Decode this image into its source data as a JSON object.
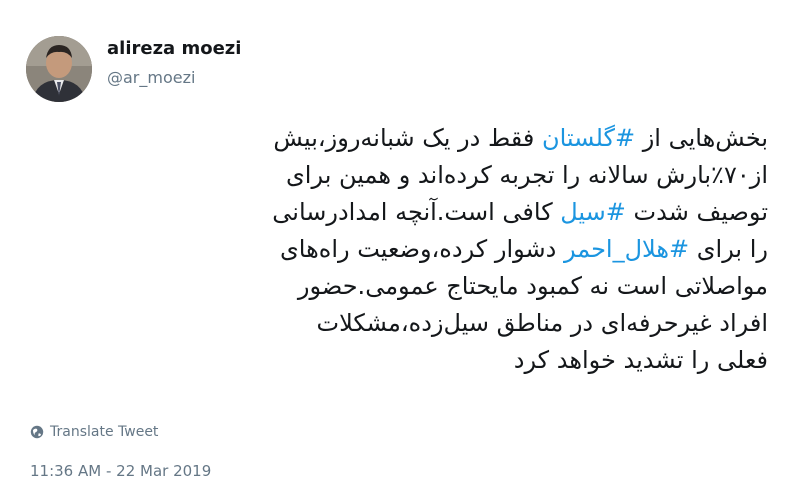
{
  "author": {
    "name": "alireza moezi",
    "handle": "@ar_moezi"
  },
  "tweet": {
    "lines": [
      [
        {
          "t": "بخش‌هایی از "
        },
        {
          "t": "#گلستان",
          "tag": true
        },
        {
          "t": " فقط در یک شبانه‌روز،بیش"
        }
      ],
      [
        {
          "t": "از۷۰٪بارش سالانه را تجربه کرده‌اند و همین برای"
        }
      ],
      [
        {
          "t": "توصیف شدت "
        },
        {
          "t": "#سیل",
          "tag": true
        },
        {
          "t": " کافی است.آنچه امدادرسانی"
        }
      ],
      [
        {
          "t": "را برای "
        },
        {
          "t": "#هلال_احمر",
          "tag": true
        },
        {
          "t": " دشوار کرده،وضعیت راه‌های"
        }
      ],
      [
        {
          "t": "مواصلاتی است نه کمبود مایحتاج عمومی.حضور"
        }
      ],
      [
        {
          "t": "افراد غیرحرفه‌ای در مناطق سیل‌زده،مشکلات"
        }
      ],
      [
        {
          "t": "فعلی را تشدید خواهد کرد"
        }
      ]
    ]
  },
  "translate_label": "Translate Tweet",
  "timestamp": "11:36 AM - 22 Mar 2019",
  "colors": {
    "hashtag": "#1b95e0",
    "secondary_text": "#657786",
    "primary_text": "#14171a"
  },
  "icons": {
    "translate": "globe-icon"
  }
}
